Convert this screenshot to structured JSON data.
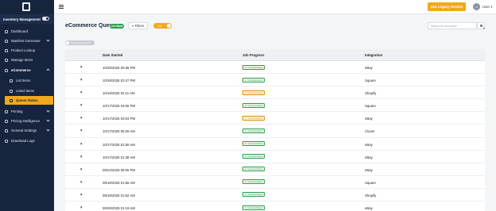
{
  "sidebar": {
    "inventory_label": "Inventory Management",
    "items": [
      {
        "label": "Dashboard",
        "icon": "dashboard-icon"
      },
      {
        "label": "Manifest Generator",
        "icon": "manifest-icon",
        "chevron": "down"
      },
      {
        "label": "Product Lookup",
        "icon": "lookup-icon"
      },
      {
        "label": "Manage Items",
        "icon": "items-icon"
      },
      {
        "label": "eCommerce",
        "icon": "ecommerce-icon",
        "chevron": "up"
      },
      {
        "label": "List Items",
        "icon": "list-icon"
      },
      {
        "label": "Listed Items",
        "icon": "listed-icon"
      },
      {
        "label": "Queue Status",
        "icon": "queue-icon"
      },
      {
        "label": "Printing",
        "icon": "printer-icon",
        "chevron": "down"
      },
      {
        "label": "Pricing Intelligence",
        "icon": "pricing-icon",
        "chevron": "down"
      },
      {
        "label": "General Settings",
        "icon": "settings-icon",
        "chevron": "down"
      },
      {
        "label": "Download Logs",
        "icon": "download-icon"
      }
    ]
  },
  "topbar": {
    "legacy_button": "Use Legacy Version",
    "user_initial": "U",
    "user_name": "User 1"
  },
  "main": {
    "title": "eCommerce Queue",
    "live_badge": "Live Mode",
    "filters_label": "Filters",
    "live_toggle": "Live",
    "search_placeholder": "Search for document",
    "grouped_toggle": "Grouped by Job ID",
    "columns": [
      "Date Started",
      "Job Progress",
      "Integration"
    ],
    "rows": [
      {
        "date": "10/28/2025 06:38 PM",
        "progress": "1 / 1 items listed",
        "status": "complete",
        "integration": "eBay"
      },
      {
        "date": "10/28/2025 02:47 PM",
        "progress": "1 / 1 items listed",
        "status": "complete",
        "integration": "Square"
      },
      {
        "date": "10/19/2025 04:11 AM",
        "progress": "0 / 5 items listed",
        "status": "pending",
        "integration": "Shopify"
      },
      {
        "date": "10/17/2025 03:06 PM",
        "progress": "5 / 5 items listed",
        "status": "complete",
        "integration": "Square"
      },
      {
        "date": "10/17/2025 03:04 PM",
        "progress": "2 / 4 items listed",
        "status": "pending",
        "integration": "eBay"
      },
      {
        "date": "10/17/2025 05:29 AM",
        "progress": "1 / 1 items listed",
        "status": "complete",
        "integration": "Clover"
      },
      {
        "date": "10/17/2025 01:55 AM",
        "progress": "1 / 1 items listed",
        "status": "complete",
        "integration": "eBay"
      },
      {
        "date": "10/17/2025 01:38 AM",
        "progress": "1 / 1 items listed",
        "status": "complete",
        "integration": "eBay"
      },
      {
        "date": "09/24/2025 06:06 PM",
        "progress": "1 / 1 items listed",
        "status": "complete",
        "integration": "eBay"
      },
      {
        "date": "09/18/2025 01:55 AM",
        "progress": "1 / 1 items listed",
        "status": "complete",
        "integration": "Square"
      },
      {
        "date": "09/18/2025 01:52 AM",
        "progress": "1 / 1 items listed",
        "status": "complete",
        "integration": "Shopify"
      },
      {
        "date": "09/25/2025 01:19 AM",
        "progress": "1 / 1 items listed",
        "status": "complete",
        "integration": "eBay"
      }
    ]
  }
}
